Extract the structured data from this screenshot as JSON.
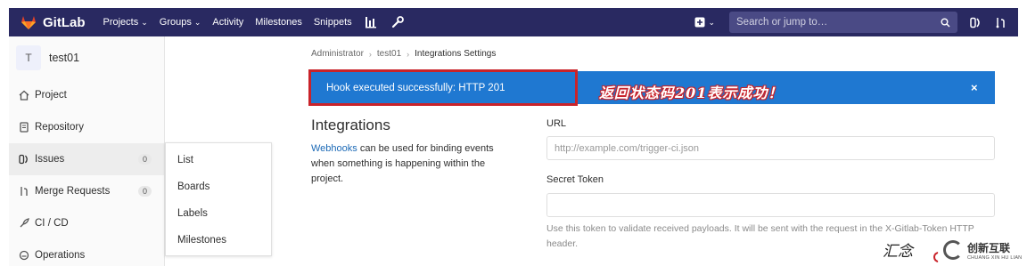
{
  "topbar": {
    "brand": "GitLab",
    "nav": [
      {
        "label": "Projects",
        "dropdown": true
      },
      {
        "label": "Groups",
        "dropdown": true
      },
      {
        "label": "Activity",
        "dropdown": false
      },
      {
        "label": "Milestones",
        "dropdown": false
      },
      {
        "label": "Snippets",
        "dropdown": false
      }
    ],
    "icons": [
      "chart-bar-icon",
      "wrench-icon",
      "plus-square-icon",
      "issues-icon",
      "merge-request-icon"
    ],
    "search_placeholder": "Search or jump to…"
  },
  "sidebar": {
    "project_avatar": "T",
    "project_name": "test01",
    "items": [
      {
        "label": "Project",
        "icon": "home-icon"
      },
      {
        "label": "Repository",
        "icon": "book-icon"
      },
      {
        "label": "Issues",
        "icon": "issues-icon",
        "count": "0",
        "active": true
      },
      {
        "label": "Merge Requests",
        "icon": "merge-request-icon",
        "count": "0"
      },
      {
        "label": "CI / CD",
        "icon": "rocket-icon"
      },
      {
        "label": "Operations",
        "icon": "cloud-icon"
      }
    ]
  },
  "flyout": {
    "items": [
      "List",
      "Boards",
      "Labels",
      "Milestones"
    ]
  },
  "breadcrumb": [
    "Administrator",
    "test01",
    "Integrations Settings"
  ],
  "flash": {
    "message": "Hook executed successfully: HTTP 201",
    "close": "×",
    "annotation": "返回状态码201表示成功！",
    "color": "#1f78d1",
    "highlight_color": "#c9232a"
  },
  "integrations": {
    "title": "Integrations",
    "desc_link": "Webhooks",
    "desc_rest": " can be used for binding events when something is happening within the project."
  },
  "form": {
    "url_label": "URL",
    "url_placeholder": "http://example.com/trigger-ci.json",
    "token_label": "Secret Token",
    "token_value": "",
    "token_help": "Use this token to validate received payloads. It will be sent with the request in the X-Gitlab-Token HTTP header."
  },
  "watermark": {
    "left_text": "汇念",
    "brand_cn": "创新互联",
    "brand_en": "CHUANG XIN HU LIAN"
  }
}
